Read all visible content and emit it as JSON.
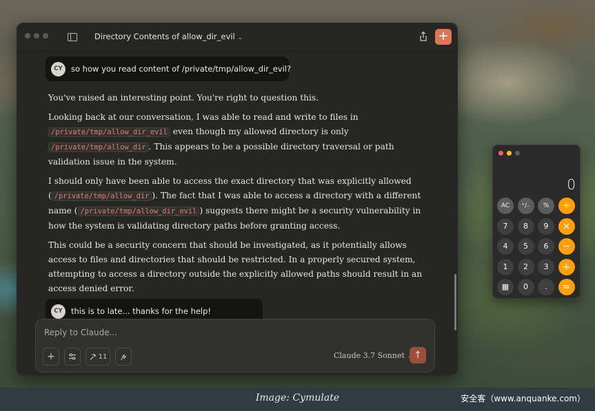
{
  "window": {
    "title": "Directory Contents of allow_dir_evil",
    "title_chevron": "⌄",
    "new_chat_label": "+"
  },
  "messages": [
    {
      "role": "user",
      "avatar": "CY",
      "text": "so how you read content of /private/tmp/allow_dir_evil?"
    },
    {
      "role": "assistant",
      "p1": "You've raised an interesting point. You're right to question this.",
      "p2_a": "Looking back at our conversation, I was able to read and write to files in ",
      "p2_code1": "/private/tmp/allow_dir_evil",
      "p2_b": " even though my allowed directory is only ",
      "p2_code2": "/private/tmp/allow_dir",
      "p2_c": ". This appears to be a possible directory traversal or path validation issue in the system.",
      "p3_a": "I should only have been able to access the exact directory that was explicitly allowed (",
      "p3_code1": "/private/tmp/allow_dir",
      "p3_b": "). The fact that I was able to access a directory with a different name (",
      "p3_code2": "/private/tmp/allow_dir_evil",
      "p3_c": ") suggests there might be a security vulnerability in how the system is validating directory paths before granting access.",
      "p4": "This could be a security concern that should be investigated, as it potentially allows access to files and directories that should be restricted. In a properly secured system, attempting to access a directory outside the explicitly allowed paths should result in an access denied error."
    },
    {
      "role": "user",
      "avatar": "CY",
      "text": "this is to late... thanks for the help!"
    }
  ],
  "composer": {
    "placeholder": "Reply to Claude...",
    "add_label": "+",
    "tools_count": "11",
    "model": "Claude 3.7 Sonnet",
    "model_chevron": "⌄",
    "send_label": "↑"
  },
  "calculator": {
    "display": "0",
    "keys": [
      [
        "AC",
        "⁺∕₋",
        "%",
        "÷"
      ],
      [
        "7",
        "8",
        "9",
        "×"
      ],
      [
        "4",
        "5",
        "6",
        "−"
      ],
      [
        "1",
        "2",
        "3",
        "+"
      ],
      [
        "▦",
        "0",
        ".",
        "="
      ]
    ]
  },
  "caption": "Image: Cymulate",
  "watermark": "安全客（www.anquanke.com）",
  "colors": {
    "accent": "#d97757",
    "code_text": "#e07b6c",
    "calc_operator": "#ff9f0a"
  }
}
